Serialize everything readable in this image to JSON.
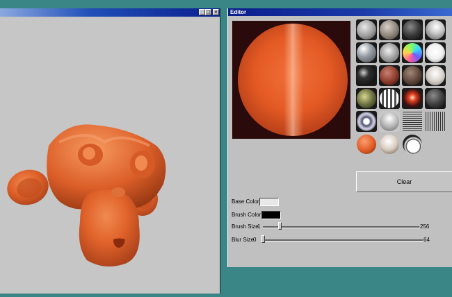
{
  "viewport": {
    "title": "",
    "title_buttons": [
      "minimize-icon",
      "maximize-icon",
      "close-icon"
    ],
    "model": "orange-monkey-head"
  },
  "editor": {
    "title": "Editor",
    "preview_color": "#e45a24",
    "matcaps": [
      [
        "grey-ball",
        "dark-grey-ball",
        "black-ball",
        "white-gloss-ball"
      ],
      [
        "grey-metal-ball",
        "chrome-ball",
        "normal-map-ball",
        "white-bright-ball"
      ],
      [
        "black-gloss-ball",
        "red-brown-ball",
        "dark-brown-ball",
        "pearl-ball"
      ],
      [
        "olive-ball",
        "striped-ball",
        "red-glow-ball",
        "charcoal-ball"
      ],
      [
        "ring-ball",
        "silver-ball",
        "horizontal-lines",
        "vertical-lines"
      ],
      [
        "orange-ball",
        "beige-ball",
        "outline-ball"
      ]
    ],
    "clear_label": "Clear",
    "base_color_label": "Base Color",
    "base_color": "#e8e8e8",
    "brush_color_label": "Brush Color",
    "brush_color": "#000000",
    "brush_size": {
      "label": "Brush Size",
      "min": "1",
      "max": "256",
      "value": 28
    },
    "blur_size": {
      "label": "Blur Size",
      "min": "0",
      "max": "64",
      "value": 0
    }
  }
}
